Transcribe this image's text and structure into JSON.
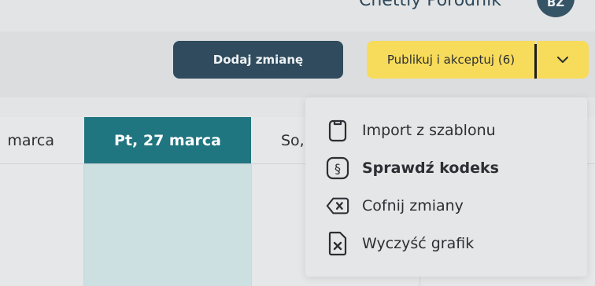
{
  "header": {
    "user_name": "Chettly Porodnik",
    "avatar_initials": "BZ"
  },
  "toolbar": {
    "add_shift_label": "Dodaj zmianę",
    "publish_label": "Publikuj i akceptuj (6)"
  },
  "calendar": {
    "columns": [
      {
        "label": "marca"
      },
      {
        "label": "Pt, 27 marca"
      },
      {
        "label": "So,"
      }
    ],
    "colors": {
      "today_header": "#1f7580",
      "today_body": "#cce0e1"
    }
  },
  "menu": {
    "items": [
      {
        "label": "Import z szablonu",
        "icon": "clipboard-icon"
      },
      {
        "label": "Sprawdź kodeks",
        "icon": "paragraph-icon"
      },
      {
        "label": "Cofnij zmiany",
        "icon": "backspace-icon"
      },
      {
        "label": "Wyczyść grafik",
        "icon": "file-x-icon"
      }
    ]
  },
  "colors": {
    "accent_yellow": "#f7db5a",
    "dark_button": "#2f4b5d"
  }
}
